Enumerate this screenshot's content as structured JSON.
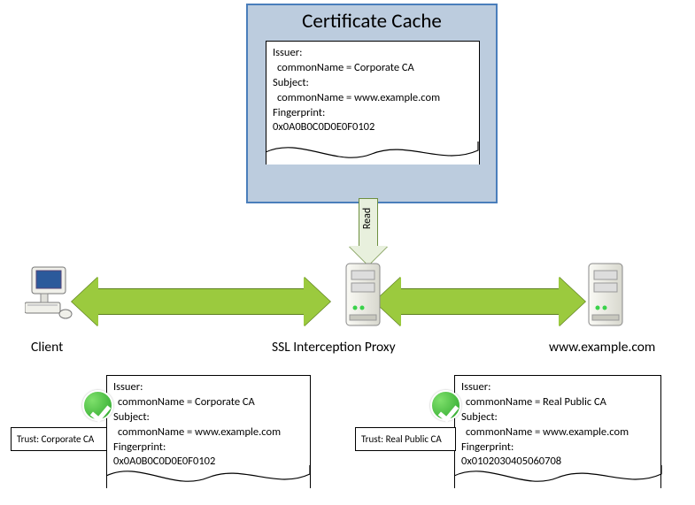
{
  "cache": {
    "title": "Certificate Cache",
    "cert": {
      "issuer_label": "Issuer:",
      "issuer_cn": " commonName = Corporate CA",
      "subject_label": "Subject:",
      "subject_cn": " commonName = www.example.com",
      "fp_label": "Fingerprint:",
      "fp": "0x0A0B0C0D0E0F0102"
    }
  },
  "read_label": "Read",
  "nodes": {
    "client": "Client",
    "proxy": "SSL Interception Proxy",
    "server": "www.example.com"
  },
  "client_cert": {
    "issuer_label": "Issuer:",
    "issuer_cn": " commonName = Corporate CA",
    "subject_label": "Subject:",
    "subject_cn": " commonName = www.example.com",
    "fp_label": "Fingerprint:",
    "fp": "0x0A0B0C0D0E0F0102",
    "trust": "Trust: Corporate CA"
  },
  "server_cert": {
    "issuer_label": "Issuer:",
    "issuer_cn": " commonName = Real Public CA",
    "subject_label": "Subject:",
    "subject_cn": " commonName = www.example.com",
    "fp_label": "Fingerprint:",
    "fp": "0x0102030405060708",
    "trust": "Trust: Real Public CA"
  }
}
